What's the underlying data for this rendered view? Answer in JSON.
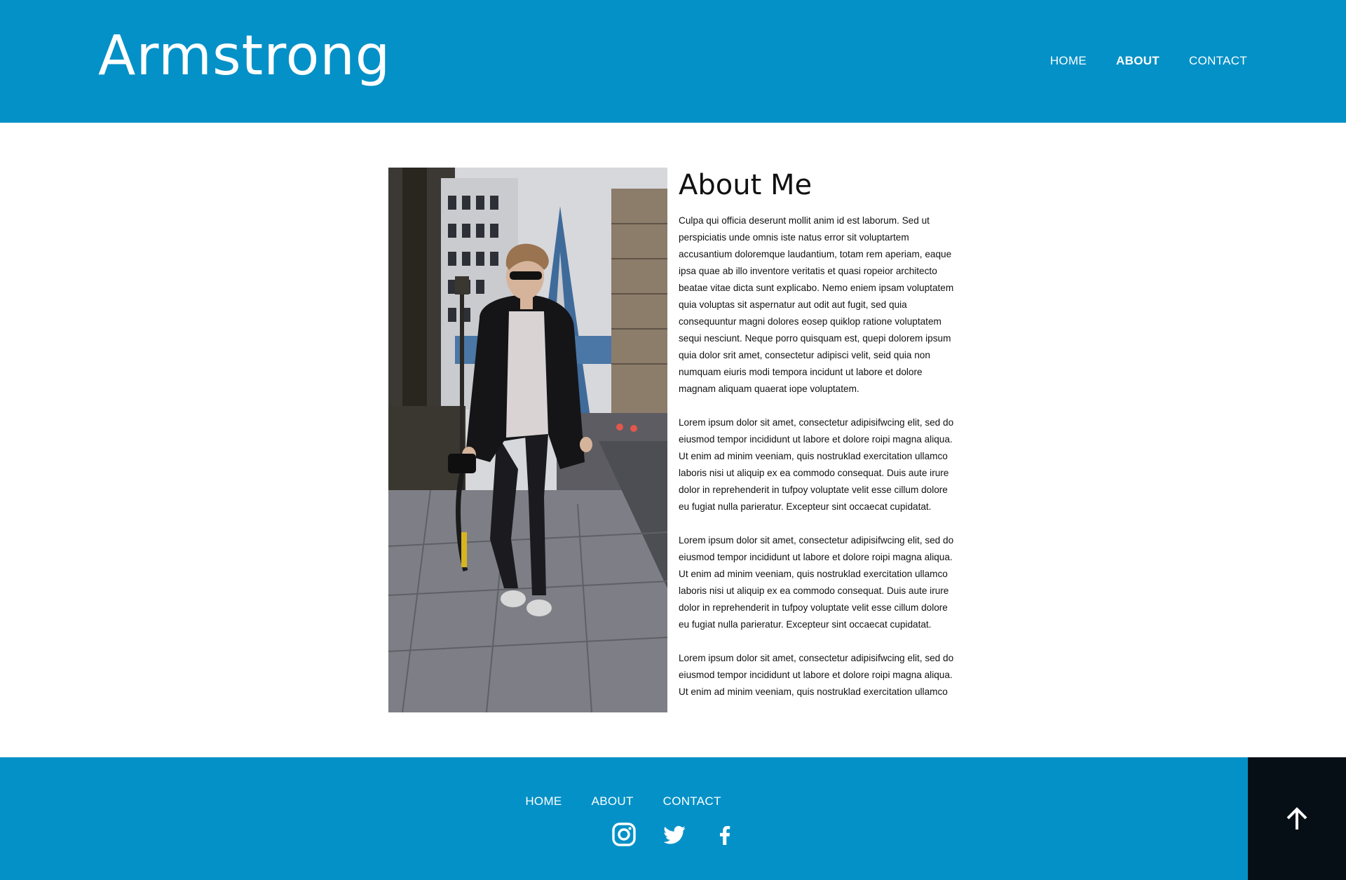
{
  "header": {
    "brand": "Armstrong",
    "nav": [
      "HOME",
      "ABOUT",
      "CONTACT"
    ],
    "active": "ABOUT"
  },
  "main": {
    "title": "About Me",
    "photo_alt": "Young man walking on a city sidewalk holding a camera",
    "paragraphs": [
      "Culpa qui officia deserunt mollit anim id est laborum. Sed ut perspiciatis unde omnis iste natus error sit voluptartem accusantium doloremque laudantium, totam rem aperiam, eaque ipsa quae ab illo inventore veritatis et quasi ropeior architecto beatae vitae dicta sunt explicabo. Nemo eniem ipsam voluptatem quia voluptas sit aspernatur aut odit aut fugit, sed quia consequuntur magni dolores eosep quiklop ratione voluptatem sequi nesciunt. Neque porro quisquam est, quepi dolorem ipsum quia dolor srit amet, consectetur adipisci velit, seid quia non numquam eiuris modi tempora incidunt ut labore et dolore magnam aliquam quaerat iope voluptatem.",
      "Lorem ipsum dolor sit amet, consectetur adipisifwcing elit, sed do eiusmod tempor incididunt ut labore et dolore roipi magna aliqua. Ut enim ad minim veeniam, quis nostruklad exercitation ullamco laboris nisi ut aliquip ex ea commodo consequat. Duis aute irure dolor in reprehenderit in tufpoy voluptate velit esse cillum dolore eu fugiat nulla parieratur. Excepteur sint occaecat cupidatat.",
      "Lorem ipsum dolor sit amet, consectetur adipisifwcing elit, sed do eiusmod tempor incididunt ut labore et dolore roipi magna aliqua. Ut enim ad minim veeniam, quis nostruklad exercitation ullamco laboris nisi ut aliquip ex ea commodo consequat. Duis aute irure dolor in reprehenderit in tufpoy voluptate velit esse cillum dolore eu fugiat nulla parieratur. Excepteur sint occaecat cupidatat.",
      "Lorem ipsum dolor sit amet, consectetur adipisifwcing elit, sed do eiusmod tempor incididunt ut labore et dolore roipi magna aliqua. Ut enim ad minim veeniam, quis nostruklad exercitation ullamco"
    ]
  },
  "footer": {
    "nav": [
      "HOME",
      "ABOUT",
      "CONTACT"
    ],
    "social": [
      "instagram-icon",
      "twitter-icon",
      "facebook-icon"
    ]
  },
  "colors": {
    "brand_blue": "#0391c7",
    "dark": "#060f16"
  }
}
